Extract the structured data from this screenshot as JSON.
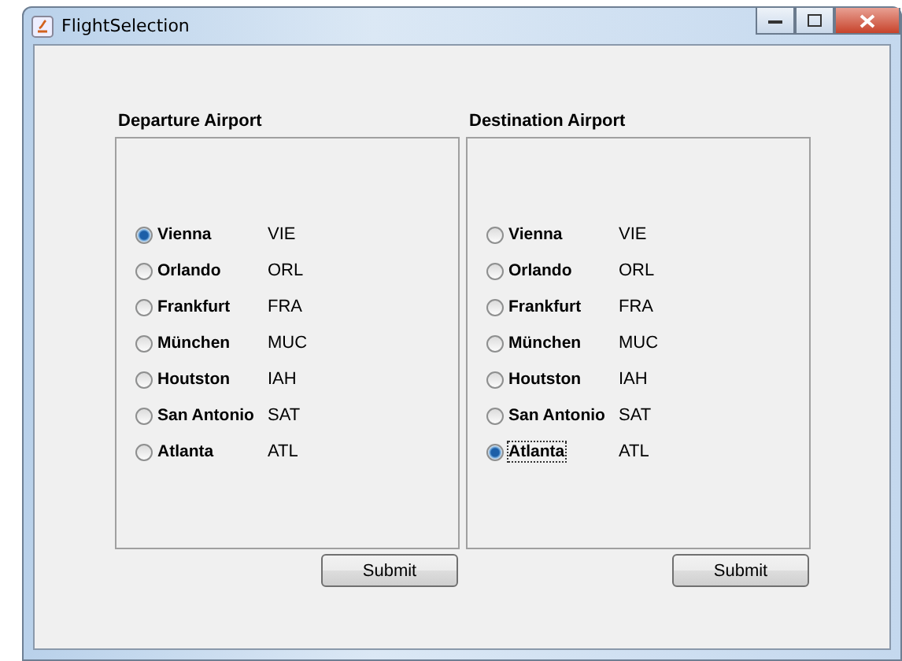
{
  "window": {
    "title": "FlightSelection"
  },
  "panels": [
    {
      "title": "Departure Airport",
      "airports": [
        {
          "name": "Vienna",
          "code": "VIE",
          "selected": true,
          "focused": false
        },
        {
          "name": "Orlando",
          "code": "ORL",
          "selected": false,
          "focused": false
        },
        {
          "name": "Frankfurt",
          "code": "FRA",
          "selected": false,
          "focused": false
        },
        {
          "name": "München",
          "code": "MUC",
          "selected": false,
          "focused": false
        },
        {
          "name": "Houtston",
          "code": "IAH",
          "selected": false,
          "focused": false
        },
        {
          "name": "San Antonio",
          "code": "SAT",
          "selected": false,
          "focused": false
        },
        {
          "name": "Atlanta",
          "code": "ATL",
          "selected": false,
          "focused": false
        }
      ],
      "button": "Submit"
    },
    {
      "title": "Destination Airport",
      "airports": [
        {
          "name": "Vienna",
          "code": "VIE",
          "selected": false,
          "focused": false
        },
        {
          "name": "Orlando",
          "code": "ORL",
          "selected": false,
          "focused": false
        },
        {
          "name": "Frankfurt",
          "code": "FRA",
          "selected": false,
          "focused": false
        },
        {
          "name": "München",
          "code": "MUC",
          "selected": false,
          "focused": false
        },
        {
          "name": "Houtston",
          "code": "IAH",
          "selected": false,
          "focused": false
        },
        {
          "name": "San Antonio",
          "code": "SAT",
          "selected": false,
          "focused": false
        },
        {
          "name": "Atlanta",
          "code": "ATL",
          "selected": true,
          "focused": true
        }
      ],
      "button": "Submit"
    }
  ]
}
